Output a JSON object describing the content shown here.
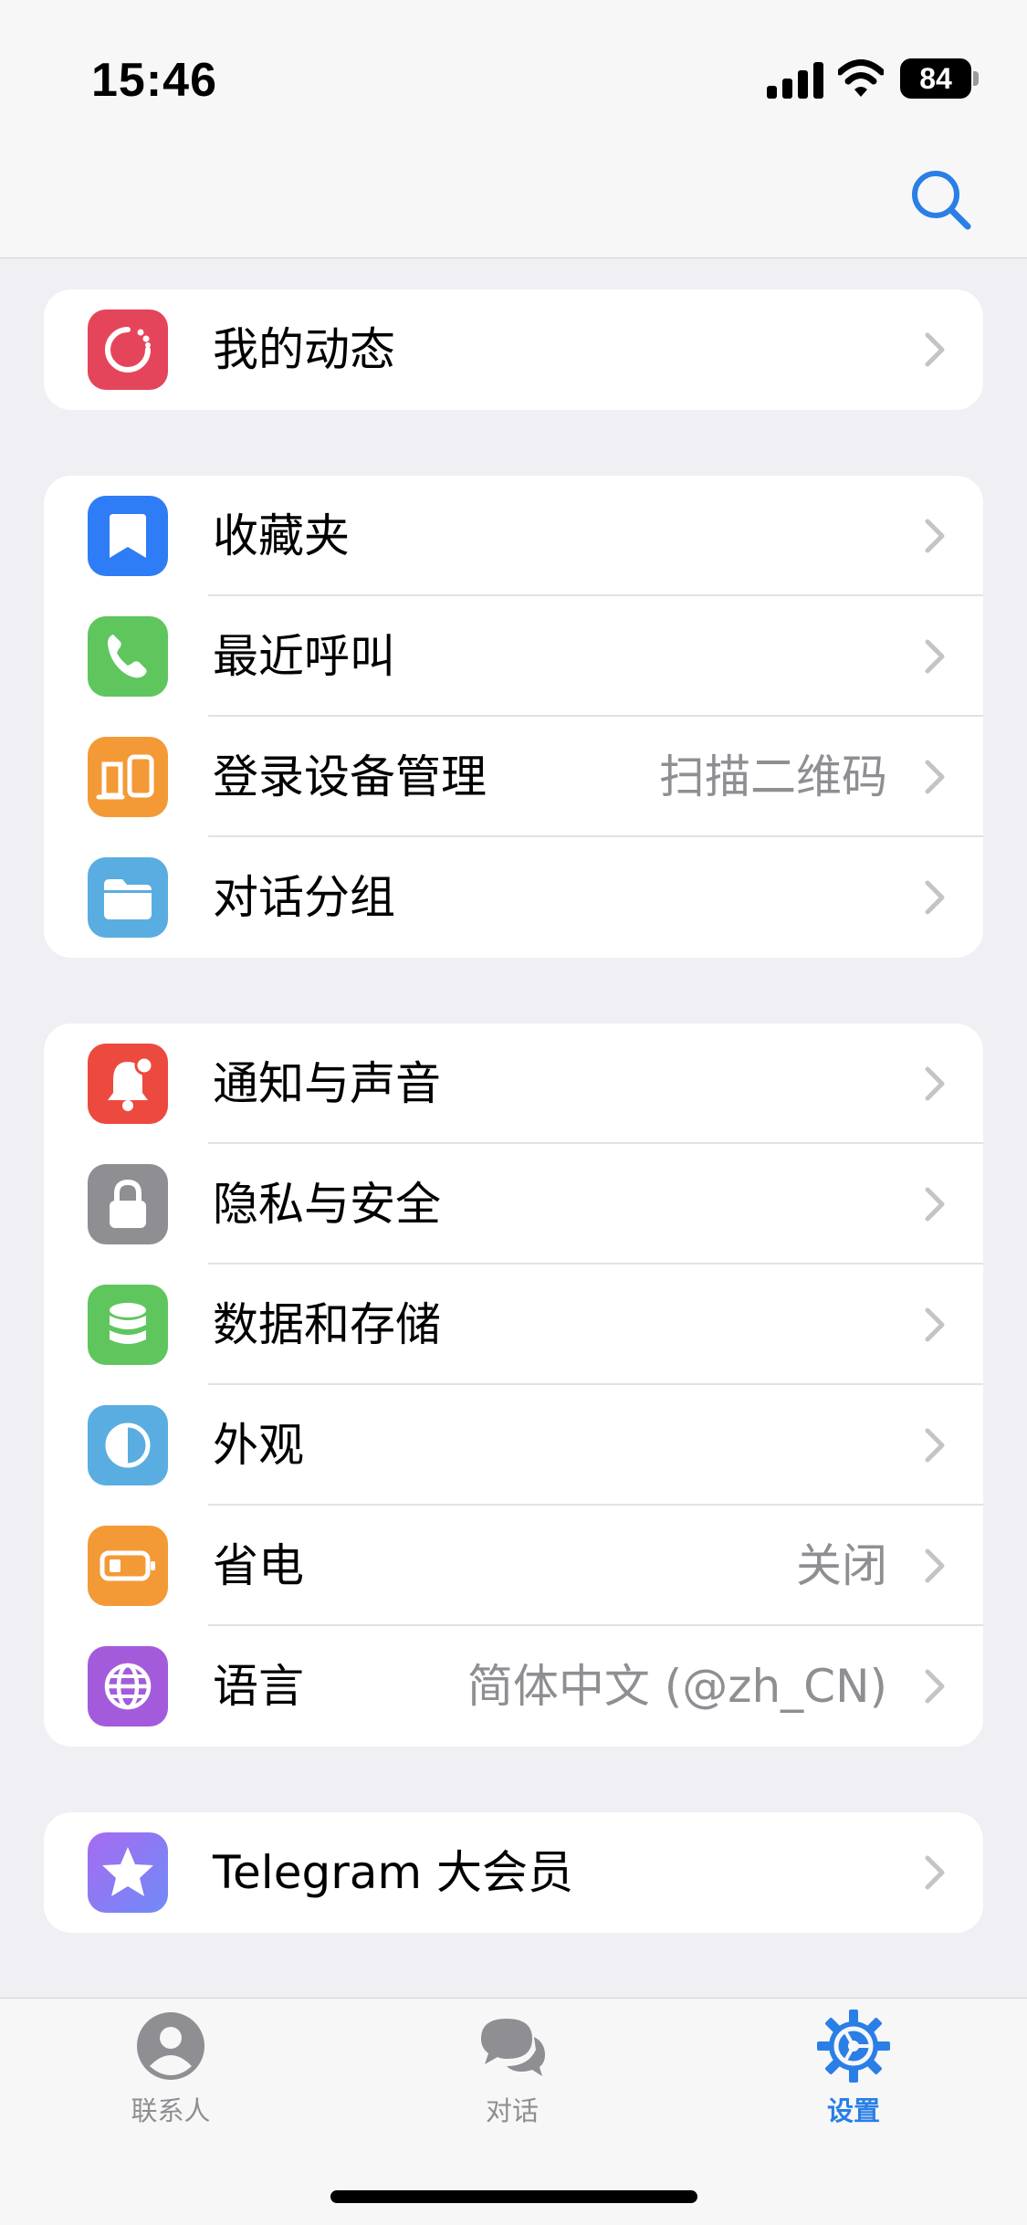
{
  "status_bar": {
    "time": "15:46",
    "battery": "84"
  },
  "groups": [
    {
      "rows": [
        {
          "label": "我的动态",
          "value": "",
          "icon": "stories-icon",
          "color": "#E5455A"
        }
      ]
    },
    {
      "rows": [
        {
          "label": "收藏夹",
          "value": "",
          "icon": "bookmark-icon",
          "color": "#2E7CF6"
        },
        {
          "label": "最近呼叫",
          "value": "",
          "icon": "phone-icon",
          "color": "#5FC65E"
        },
        {
          "label": "登录设备管理",
          "value": "扫描二维码",
          "icon": "devices-icon",
          "color": "#F39A36"
        },
        {
          "label": "对话分组",
          "value": "",
          "icon": "folder-icon",
          "color": "#5AADE0"
        }
      ]
    },
    {
      "rows": [
        {
          "label": "通知与声音",
          "value": "",
          "icon": "bell-icon",
          "color": "#EC4A3F"
        },
        {
          "label": "隐私与安全",
          "value": "",
          "icon": "lock-icon",
          "color": "#8E8E93"
        },
        {
          "label": "数据和存储",
          "value": "",
          "icon": "database-icon",
          "color": "#5FC65E"
        },
        {
          "label": "外观",
          "value": "",
          "icon": "appearance-icon",
          "color": "#5AADE0"
        },
        {
          "label": "省电",
          "value": "关闭",
          "icon": "battery-saver-icon",
          "color": "#F39A36"
        },
        {
          "label": "语言",
          "value": "简体中文 (@zh_CN)",
          "icon": "globe-icon",
          "color": "#A35BDB"
        }
      ]
    },
    {
      "rows": [
        {
          "label": "Telegram 大会员",
          "value": "",
          "icon": "premium-star-icon",
          "color": "#8C6CF0"
        }
      ]
    }
  ],
  "tabs": [
    {
      "label": "联系人",
      "icon": "contacts-icon",
      "active": false
    },
    {
      "label": "对话",
      "icon": "chats-icon",
      "active": false
    },
    {
      "label": "设置",
      "icon": "settings-icon",
      "active": true
    }
  ],
  "colors": {
    "accent": "#2A7FE7",
    "background": "#EFEFF4",
    "inactive": "#8E8E93"
  }
}
